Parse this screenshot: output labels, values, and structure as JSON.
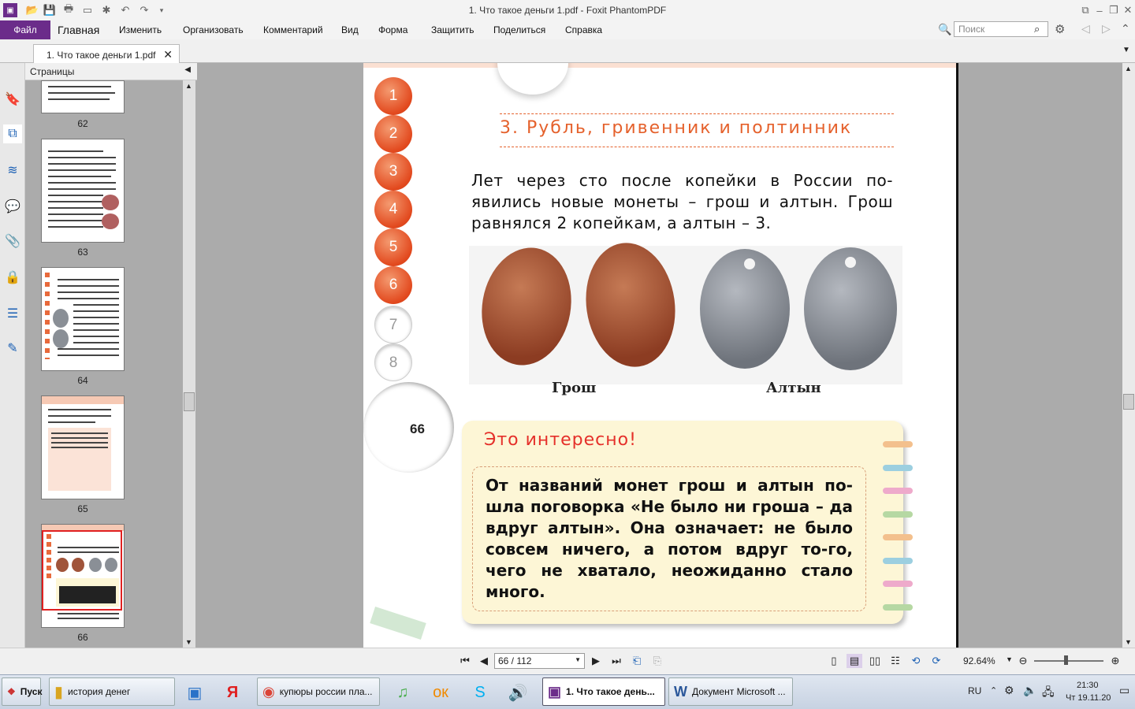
{
  "app": {
    "title": "1. Что такое деньги 1.pdf - Foxit PhantomPDF"
  },
  "menu": {
    "file": "Файл",
    "items": [
      "Главная",
      "Изменить",
      "Организовать",
      "Комментарий",
      "Вид",
      "Форма",
      "Защитить",
      "Поделиться",
      "Справка"
    ]
  },
  "search": {
    "placeholder": "Поиск"
  },
  "tab": {
    "label": "1. Что такое деньги 1.pdf"
  },
  "panel": {
    "title": "Страницы",
    "thumbs": [
      "62",
      "63",
      "64",
      "65",
      "66"
    ]
  },
  "doc": {
    "page_number": "66",
    "nav_numbers": [
      "1",
      "2",
      "3",
      "4",
      "5",
      "6",
      "7",
      "8"
    ],
    "heading": "3.  Рубль,  гривенник  и  полтинник",
    "paragraph": "Лет через сто после копейки в России по-явились новые монеты – грош и алтын. Грош равнялся 2 копейкам, а алтын – 3.",
    "caption_left": "Грош",
    "caption_right": "Алтын",
    "box_title": "Это  интересно!",
    "box_text": "От названий монет грош и алтын по-шла поговорка «Не было ни гроша – да вдруг алтын». Она означает: не было совсем ничего, а потом вдруг то-го, чего не хватало, неожиданно стало много."
  },
  "nav": {
    "page_field": "66 / 112",
    "zoom": "92.64%"
  },
  "taskbar": {
    "start": "Пуск",
    "items": [
      "история денег",
      "купюры россии пла...",
      "1. Что такое день...",
      "Документ Microsoft ..."
    ],
    "lang": "RU",
    "time": "21:30",
    "date": "Чт 19.11.20"
  },
  "colors": {
    "accent": "#6b2c8a",
    "orange": "#e5612c"
  }
}
